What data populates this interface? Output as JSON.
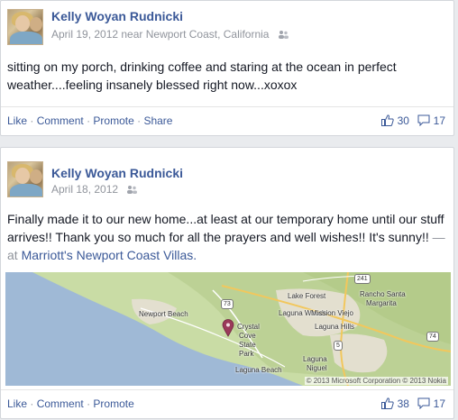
{
  "posts": [
    {
      "author": "Kelly Woyan Rudnicki",
      "meta": "April 19, 2012 near Newport Coast, California",
      "text": "sitting on my porch, drinking coffee and staring at the ocean in perfect weather....feeling insanely blessed right now...xoxox",
      "actions": [
        "Like",
        "Comment",
        "Promote",
        "Share"
      ],
      "likes": "30",
      "comments": "17"
    },
    {
      "author": "Kelly Woyan Rudnicki",
      "meta": "April 18, 2012",
      "text": "Finally made it to our new home...at least at our temporary home until our stuff arrives!! Thank you so much for all the prayers and well wishes!! It's sunny!!",
      "at_text": "— at",
      "place": "Marriott's Newport Coast Villas.",
      "actions": [
        "Like",
        "Comment",
        "Promote"
      ],
      "likes": "38",
      "comments": "17"
    }
  ],
  "map": {
    "labels": {
      "newport_beach": "Newport Beach",
      "lake_forest": "Lake Forest",
      "rancho": "Rancho Santa",
      "margarita": "Margarita",
      "laguna_woods": "Laguna Woods",
      "mission_viejo": "Mission Viejo",
      "crystal": "Crystal",
      "cove": "Cove",
      "state": "State",
      "park": "Park",
      "laguna_hills": "Laguna Hills",
      "laguna_beach": "Laguna Beach",
      "laguna": "Laguna",
      "niguel": "Niguel"
    },
    "shields": [
      "73",
      "241",
      "5",
      "74"
    ],
    "copyright": "© 2013 Microsoft Corporation © 2013 Nokia"
  },
  "colors": {
    "link": "#3b5998",
    "meta": "#90949c",
    "water": "#9fb9d6",
    "land": "#c9dca5"
  },
  "icons": {
    "friends": "friends-icon",
    "like": "thumbs-up-icon",
    "comment": "comment-bubble-icon",
    "pin": "map-pin-icon"
  }
}
